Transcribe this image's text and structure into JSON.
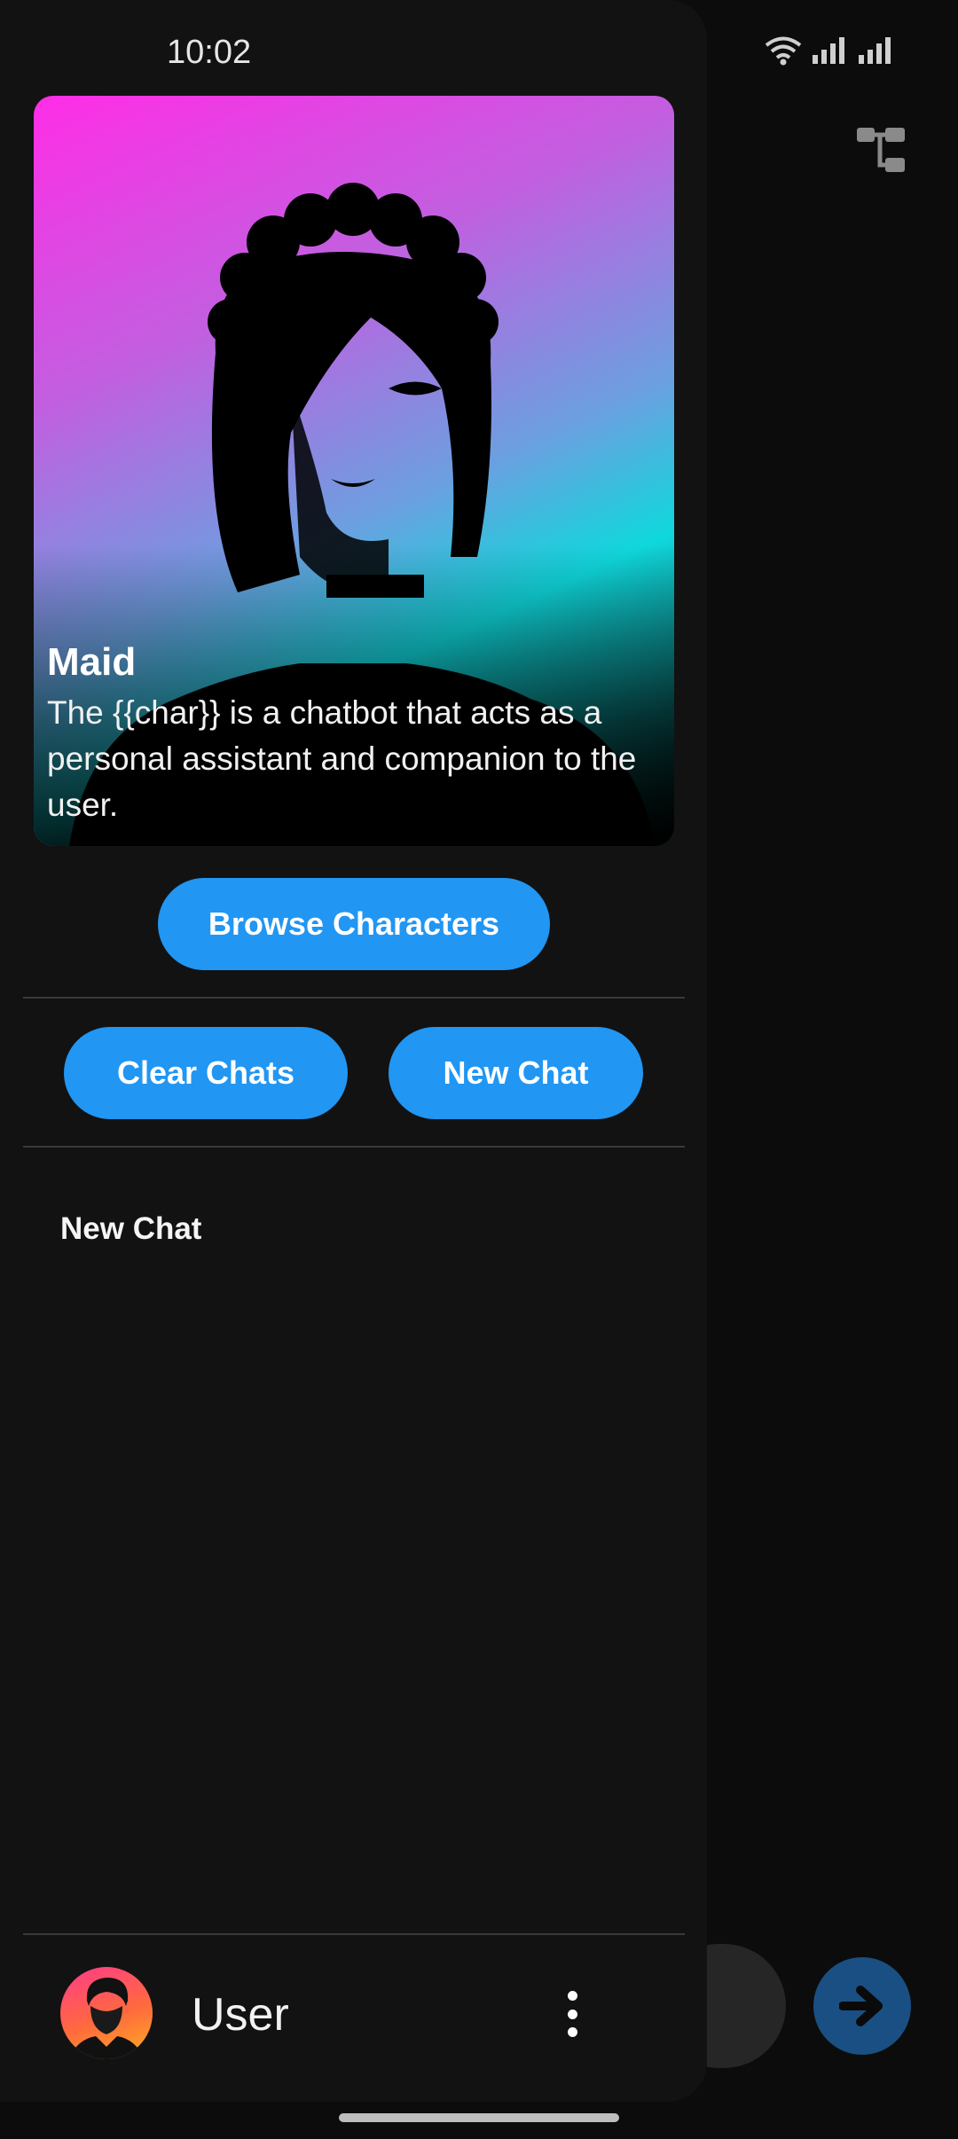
{
  "status_bar": {
    "time": "10:02",
    "icons": [
      "wifi-icon",
      "signal-icon",
      "signal-icon"
    ]
  },
  "background_app": {
    "icons": [
      "tree-view-icon",
      "arrow-right-icon"
    ]
  },
  "character_card": {
    "name": "Maid",
    "description": "The {{char}} is a chatbot that acts as a personal assistant and companion to the user."
  },
  "buttons": {
    "browse": "Browse Characters",
    "clear": "Clear Chats",
    "new_chat": "New Chat"
  },
  "chats": [
    {
      "title": "New Chat"
    }
  ],
  "user": {
    "name": "User"
  },
  "colors": {
    "accent": "#2196f3",
    "drawer_bg": "#121212",
    "send_button": "#1a4f83"
  }
}
